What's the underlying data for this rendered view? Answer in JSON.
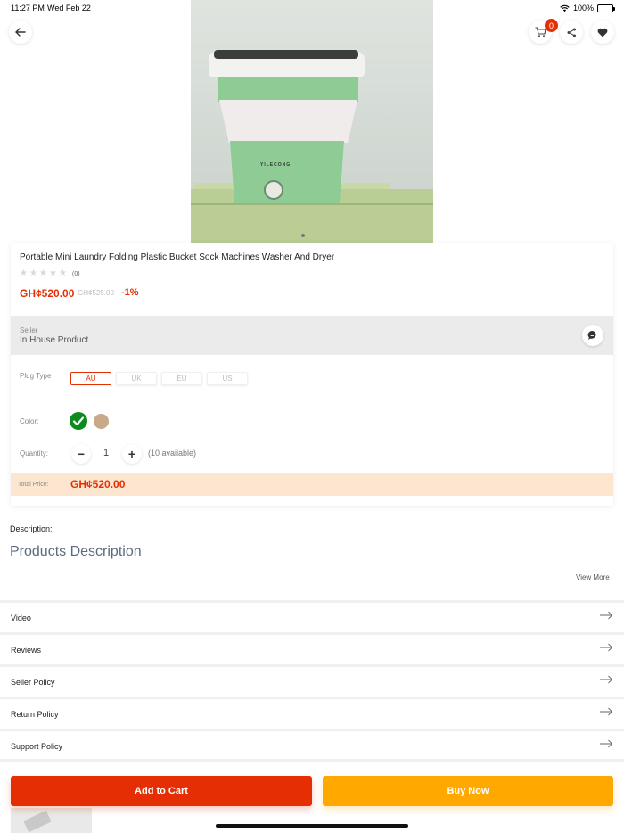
{
  "status_bar": {
    "time": "11:27 PM",
    "date": "Wed Feb 22",
    "battery": "100%",
    "dots": "•••"
  },
  "hero": {
    "brand_text": "YILECONG",
    "pager_count": 1
  },
  "header": {
    "cart_count": "0"
  },
  "product": {
    "title": "Portable Mini Laundry Folding Plastic Bucket Sock Machines Washer And Dryer",
    "rating_count": "(0)",
    "price": "GH¢520.00",
    "old_price": "GH¢525.00",
    "discount": "-1%"
  },
  "seller": {
    "label": "Seller",
    "name": "In House Product"
  },
  "plug": {
    "label": "Plug Type",
    "options": [
      "AU",
      "UK",
      "EU",
      "US"
    ],
    "selected": "AU"
  },
  "color": {
    "label": "Color:",
    "swatches": [
      "#0b8a1d",
      "#c8a98a"
    ],
    "selected_index": 0
  },
  "quantity": {
    "label": "Quantity:",
    "value": "1",
    "minus": "−",
    "plus": "+",
    "available": "(10 available)"
  },
  "total": {
    "label": "Total Price:",
    "value": "GH¢520.00"
  },
  "description": {
    "label": "Description:",
    "heading": "Products Description",
    "view_more": "View More"
  },
  "sections": [
    "Video",
    "Reviews",
    "Seller Policy",
    "Return Policy",
    "Support Policy"
  ],
  "actions": {
    "add_to_cart": "Add to Cart",
    "buy_now": "Buy Now"
  },
  "colors": {
    "accent_red": "#e62e04",
    "buy_orange": "#ffa800",
    "total_bg": "#fde6cf"
  }
}
